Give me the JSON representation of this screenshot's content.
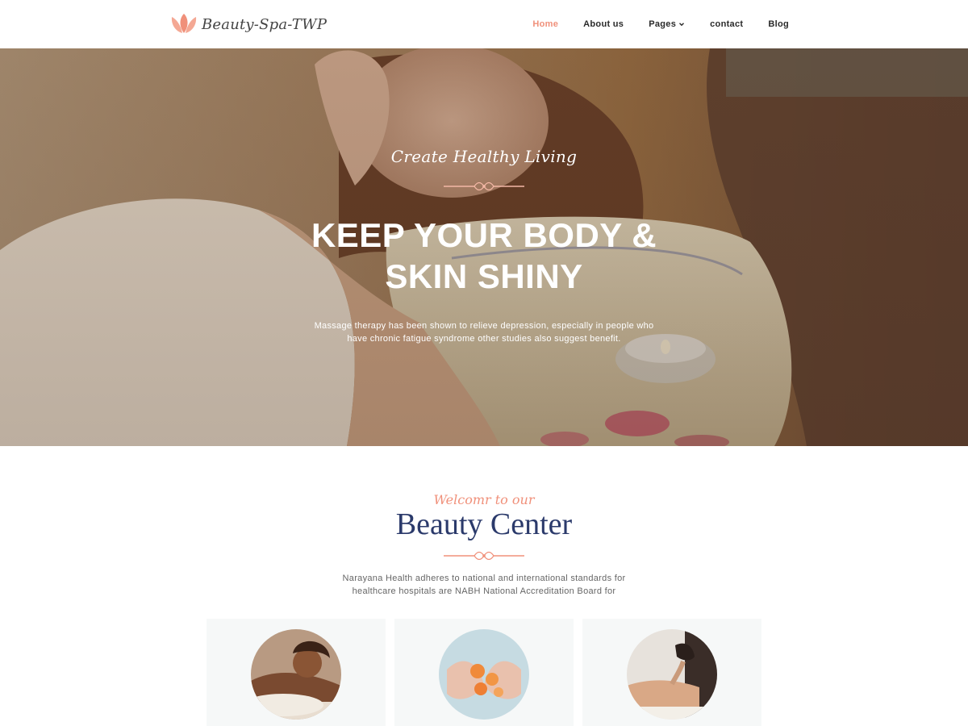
{
  "brand": {
    "name": "Beauty-Spa-TWP",
    "accent_color": "#f0907a",
    "heading_color": "#2b3a6b",
    "icon": "lotus-logo-icon"
  },
  "nav": {
    "items": [
      {
        "label": "Home",
        "active": true
      },
      {
        "label": "About us",
        "active": false
      },
      {
        "label": "Pages",
        "active": false,
        "icon": "chevron-down-icon"
      },
      {
        "label": "contact",
        "active": false
      },
      {
        "label": "Blog",
        "active": false
      }
    ]
  },
  "hero": {
    "tagline": "Create Healthy Living",
    "title_line1": "KEEP YOUR BODY &",
    "title_line2": "SKIN SHINY",
    "text_line1": "Massage therapy has been shown to relieve depression, especially in people who",
    "text_line2": "have chronic fatigue syndrome other studies also suggest benefit.",
    "image": "facial-massage-photo"
  },
  "welcome": {
    "tagline": "Welcomr to our",
    "title": "Beauty Center",
    "text_line1": "Narayana Health adheres to national and international standards for",
    "text_line2": "healthcare hospitals are NABH National Accreditation Board for"
  },
  "cards": [
    {
      "image": "smiling-woman-spa-photo"
    },
    {
      "image": "hands-with-flowers-photo"
    },
    {
      "image": "back-massage-photo"
    }
  ]
}
